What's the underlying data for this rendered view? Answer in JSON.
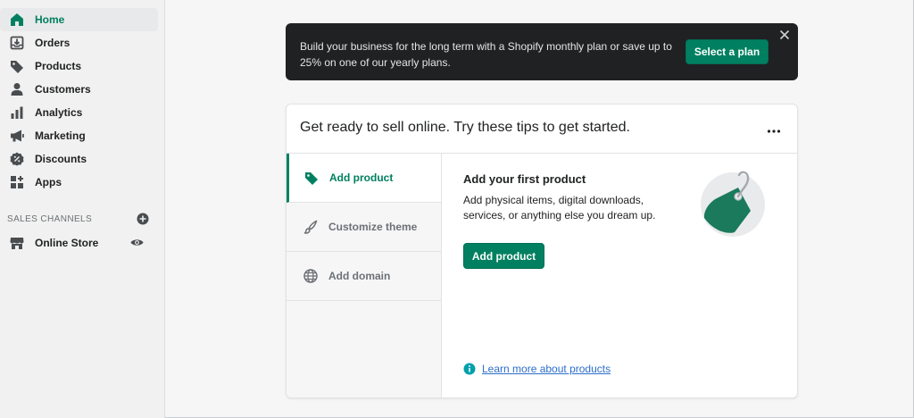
{
  "sidebar": {
    "items": [
      {
        "label": "Home",
        "icon": "home-icon"
      },
      {
        "label": "Orders",
        "icon": "orders-icon"
      },
      {
        "label": "Products",
        "icon": "tag-icon"
      },
      {
        "label": "Customers",
        "icon": "person-icon"
      },
      {
        "label": "Analytics",
        "icon": "bar-chart-icon"
      },
      {
        "label": "Marketing",
        "icon": "megaphone-icon"
      },
      {
        "label": "Discounts",
        "icon": "discount-icon"
      },
      {
        "label": "Apps",
        "icon": "apps-icon"
      }
    ],
    "sales_channels_heading": "SALES CHANNELS",
    "online_store": "Online Store"
  },
  "banner": {
    "text": "Build your business for the long term with a Shopify monthly plan or save up to 25% on one of our yearly plans.",
    "button": "Select a plan"
  },
  "card": {
    "title": "Get ready to sell online. Try these tips to get started.",
    "tabs": [
      {
        "label": "Add product",
        "icon": "tag-icon"
      },
      {
        "label": "Customize theme",
        "icon": "brush-icon"
      },
      {
        "label": "Add domain",
        "icon": "globe-icon"
      }
    ],
    "content": {
      "title": "Add your first product",
      "description": "Add physical items, digital downloads, services, or anything else you dream up.",
      "button": "Add product",
      "learn_more": "Learn more about products"
    }
  },
  "colors": {
    "accent": "#008060",
    "banner_bg": "#202123",
    "link": "#2c6ecb"
  }
}
